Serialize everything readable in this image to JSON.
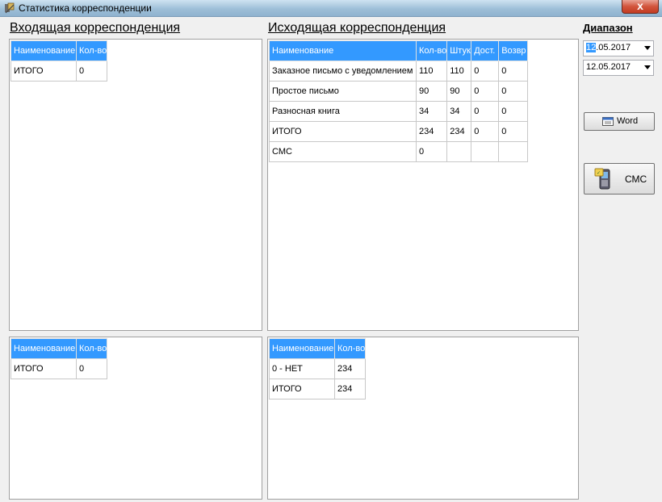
{
  "window": {
    "title": "Статистика корреспонденции",
    "close_label": "x"
  },
  "incoming": {
    "heading": "Входящая корреспонденция",
    "top_table": {
      "headers": [
        "Наименование",
        "Кол-во"
      ],
      "rows": [
        [
          "ИТОГО",
          "0"
        ]
      ]
    },
    "bottom_table": {
      "headers": [
        "Наименование",
        "Кол-во"
      ],
      "rows": [
        [
          "ИТОГО",
          "0"
        ]
      ]
    }
  },
  "outgoing": {
    "heading": "Исходящая корреспонденция",
    "top_table": {
      "headers": [
        "Наименование",
        "Кол-во",
        "Штук",
        "Дост.",
        "Возвр"
      ],
      "rows": [
        [
          "Заказное письмо с уведомлением",
          "110",
          "110",
          "0",
          "0"
        ],
        [
          "Простое письмо",
          "90",
          "90",
          "0",
          "0"
        ],
        [
          "Разносная книга",
          "34",
          "34",
          "0",
          "0"
        ],
        [
          "ИТОГО",
          "234",
          "234",
          "0",
          "0"
        ],
        [
          "СМС",
          "0",
          "",
          "",
          ""
        ]
      ]
    },
    "bottom_table": {
      "headers": [
        "Наименование",
        "Кол-во"
      ],
      "rows": [
        [
          "0 - НЕТ",
          "234"
        ],
        [
          "ИТОГО",
          "234"
        ]
      ]
    }
  },
  "range": {
    "heading": "Диапазон",
    "date_from_selected": "12",
    "date_from_rest": ".05.2017",
    "date_to": "12.05.2017"
  },
  "buttons": {
    "word_label": "Word",
    "sms_label": "СМС"
  },
  "colors": {
    "header_bg": "#3399ff",
    "panel_bg": "#ffffff",
    "client_bg": "#f0f0f0"
  }
}
